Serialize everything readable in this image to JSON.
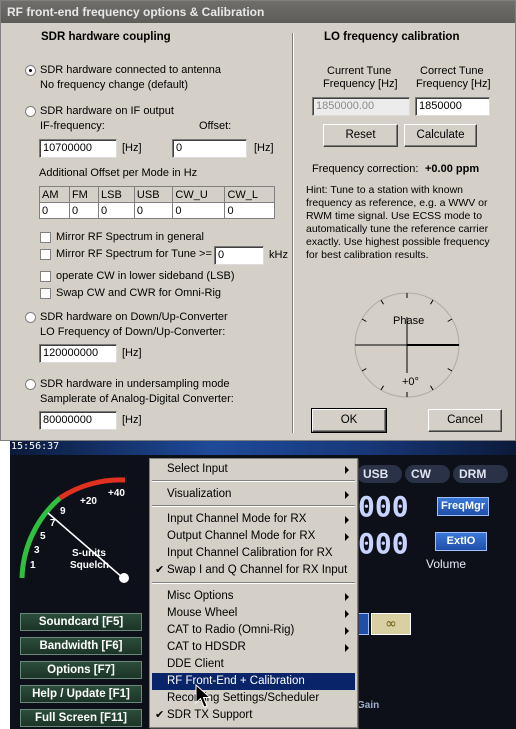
{
  "dialog": {
    "title": "RF front-end frequency options & Calibration",
    "sdr_section_title": "SDR hardware coupling",
    "radio_antenna_line1": "SDR hardware connected to antenna",
    "radio_antenna_line2": "No frequency change (default)",
    "radio_if_label": "SDR hardware on IF output",
    "if_freq_label": "IF-frequency:",
    "offset_label": "Offset:",
    "if_freq_value": "10700000",
    "if_unit": "[Hz]",
    "offset_value": "0",
    "offset_unit": "[Hz]",
    "mode_offset_label": "Additional Offset per Mode in Hz",
    "mode_headers": [
      "AM",
      "FM",
      "LSB",
      "USB",
      "CW_U",
      "CW_L"
    ],
    "mode_values": [
      "0",
      "0",
      "0",
      "0",
      "0",
      "0"
    ],
    "mirror_general": "Mirror RF Spectrum in general",
    "mirror_tune": "Mirror RF Spectrum for Tune >=",
    "mirror_tune_value": "0",
    "mirror_tune_unit": "kHz",
    "cw_lsb": "operate CW in lower sideband (LSB)",
    "swap_cw": "Swap CW and CWR for Omni-Rig",
    "radio_downup_line1": "SDR hardware on Down/Up-Converter",
    "radio_downup_line2": "LO Frequency of Down/Up-Converter:",
    "lo_value": "120000000",
    "lo_unit": "[Hz]",
    "radio_undersampling_line1": "SDR hardware in undersampling mode",
    "radio_undersampling_line2": "Samplerate of Analog-Digital Converter:",
    "adc_value": "80000000",
    "adc_unit": "[Hz]",
    "lo_section_title": "LO frequency calibration",
    "current_tune_label1": "Current Tune",
    "current_tune_label2": "Frequency [Hz]",
    "correct_tune_label1": "Correct Tune",
    "correct_tune_label2": "Frequency [Hz]",
    "current_tune_value": "1850000.00",
    "correct_tune_value": "1850000",
    "reset_label": "Reset",
    "calculate_label": "Calculate",
    "freq_correction_label": "Frequency correction:",
    "freq_correction_value": "+0.00 ppm",
    "hint_lines": [
      "Hint: Tune to a station with known",
      "frequency as reference, e.g. a WWV or",
      "RWM time signal. Use ECSS mode to",
      "automatically tune the reference carrier",
      "exactly. Use highest possible frequency",
      "for best calibration results."
    ],
    "phase_label": "Phase",
    "phase_value": "+0°",
    "ok_label": "OK",
    "cancel_label": "Cancel"
  },
  "radio": {
    "time": "15:56:37",
    "meter_labels": [
      "+40",
      "+20",
      "9",
      "7",
      "5",
      "3",
      "1"
    ],
    "s_units_label": "S-units",
    "squelch_label": "Squelch",
    "mode_buttons": [
      "USB",
      "CW",
      "DRM"
    ],
    "digits_row1": "000",
    "digits_row2": "000",
    "freqmgr_label": "FreqMgr",
    "extio_label": "ExtIO",
    "volume_label": "Volume",
    "gain_label": "Gain",
    "nav_buttons": [
      "Soundcard  [F5]",
      "Bandwidth  [F6]",
      "Options  [F7]",
      "Help / Update  [F1]",
      "Full Screen  [F11]"
    ]
  },
  "menu": {
    "items": [
      {
        "label": "Select Input",
        "submenu": true
      },
      {
        "label": "Visualization",
        "submenu": true
      },
      {
        "label": "Input Channel Mode for RX",
        "submenu": true
      },
      {
        "label": "Output Channel Mode for RX",
        "submenu": true
      },
      {
        "label": "Input Channel Calibration for RX",
        "submenu": false
      },
      {
        "label": "Swap I and Q Channel for RX Input",
        "submenu": false,
        "checked": true
      },
      {
        "label": "Misc Options",
        "submenu": true
      },
      {
        "label": "Mouse Wheel",
        "submenu": true
      },
      {
        "label": "CAT to Radio (Omni-Rig)",
        "submenu": true
      },
      {
        "label": "CAT to HDSDR",
        "submenu": true
      },
      {
        "label": "DDE Client",
        "submenu": false
      },
      {
        "label": "RF Front-End + Calibration",
        "submenu": false,
        "selected": true
      },
      {
        "label": "Recording Settings/Scheduler",
        "submenu": false
      },
      {
        "label": "SDR TX Support",
        "submenu": false,
        "checked": true
      }
    ]
  },
  "colors": {
    "menu_highlight": "#0a246a",
    "dialog_face": "#d4d0c8",
    "meter_red": "#e03020",
    "meter_green": "#30c040"
  }
}
